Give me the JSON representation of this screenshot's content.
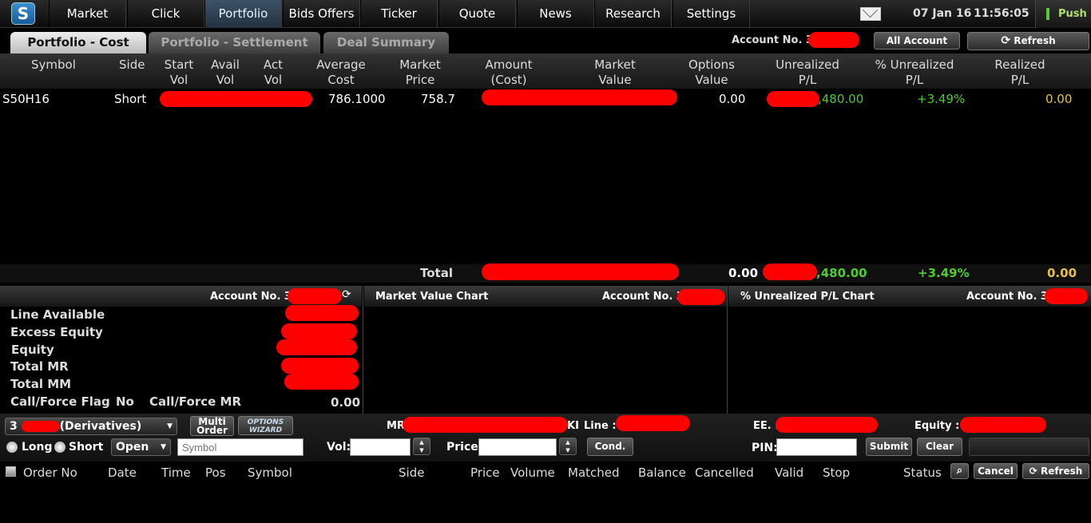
{
  "nav": {
    "logo": "S",
    "items": [
      "Market",
      "Click",
      "Portfolio",
      "Bids Offers",
      "Ticker",
      "Quote",
      "News",
      "Research",
      "Settings"
    ],
    "active": "Portfolio",
    "date": "07 Jan 16",
    "time": "11:56:05",
    "push": "Push"
  },
  "tabs": [
    "Portfolio - Cost",
    "Portfolio - Settlement",
    "Deal Summary"
  ],
  "account_label": "Account No. 3",
  "all_account": "All Account",
  "refresh": "Refresh",
  "columns": [
    [
      "Symbol",
      ""
    ],
    [
      "Side",
      ""
    ],
    [
      "Start",
      "Vol"
    ],
    [
      "Avail",
      "Vol"
    ],
    [
      "Act",
      "Vol"
    ],
    [
      "Average",
      "Cost"
    ],
    [
      "Market",
      "Price"
    ],
    [
      "Amount",
      "(Cost)"
    ],
    [
      "Market",
      "Value"
    ],
    [
      "Options",
      "Value"
    ],
    [
      "Unrealized",
      "P/L"
    ],
    [
      "% Unrealized",
      "P/L"
    ],
    [
      "Realized",
      "P/L"
    ]
  ],
  "row": {
    "symbol": "S50H16",
    "side": "Short",
    "avg_cost": "786.1000",
    "market_price": "758.7",
    "options_value": "0.00",
    "unrealized": ",480.00",
    "pct_unrealized": "+3.49%",
    "realized": "0.00"
  },
  "total": {
    "label": "Total",
    "options_value": "0.00",
    "unrealized": ",480.00",
    "pct_unrealized": "+3.49%",
    "realized": "0.00"
  },
  "summary": {
    "account_label": "Account No. 3",
    "labels": [
      "Line Available",
      "Excess Equity",
      "Equity",
      "Total MR",
      "Total MM"
    ],
    "flag_label": "Call/Force Flag",
    "flag_value": "No",
    "force_mr_label": "Call/Force MR",
    "force_mr_value": "0.00"
  },
  "mv_chart": {
    "title": "Market Value Chart",
    "account_label": "Account No. 3"
  },
  "pl_chart": {
    "title": "% Unrealized P/L Chart",
    "account_label": "Account No. 3"
  },
  "order": {
    "account_prefix": "3",
    "account_suffix": "(Derivatives)",
    "multi_order": "Multi Order",
    "options_wizard_1": "OPTIONS",
    "options_wizard_2": "WIZARD",
    "mr_label": "MR",
    "ki_label": "KI",
    "line_label": "Line :",
    "ee_label": "EE. :",
    "equity_label": "Equity :",
    "long": "Long",
    "short": "Short",
    "position": "Open",
    "symbol_placeholder": "Symbol",
    "vol_label": "Vol:",
    "price_label": "Price:",
    "cond": "Cond.",
    "pin_label": "PIN:",
    "submit": "Submit",
    "clear": "Clear"
  },
  "order_columns": [
    "Order No",
    "Date",
    "Time",
    "Pos",
    "Symbol",
    "Side",
    "Price",
    "Volume",
    "Matched",
    "Balance",
    "Cancelled",
    "Valid",
    "Stop",
    "Status"
  ],
  "order_buttons": {
    "cancel": "Cancel",
    "refresh": "Refresh"
  }
}
